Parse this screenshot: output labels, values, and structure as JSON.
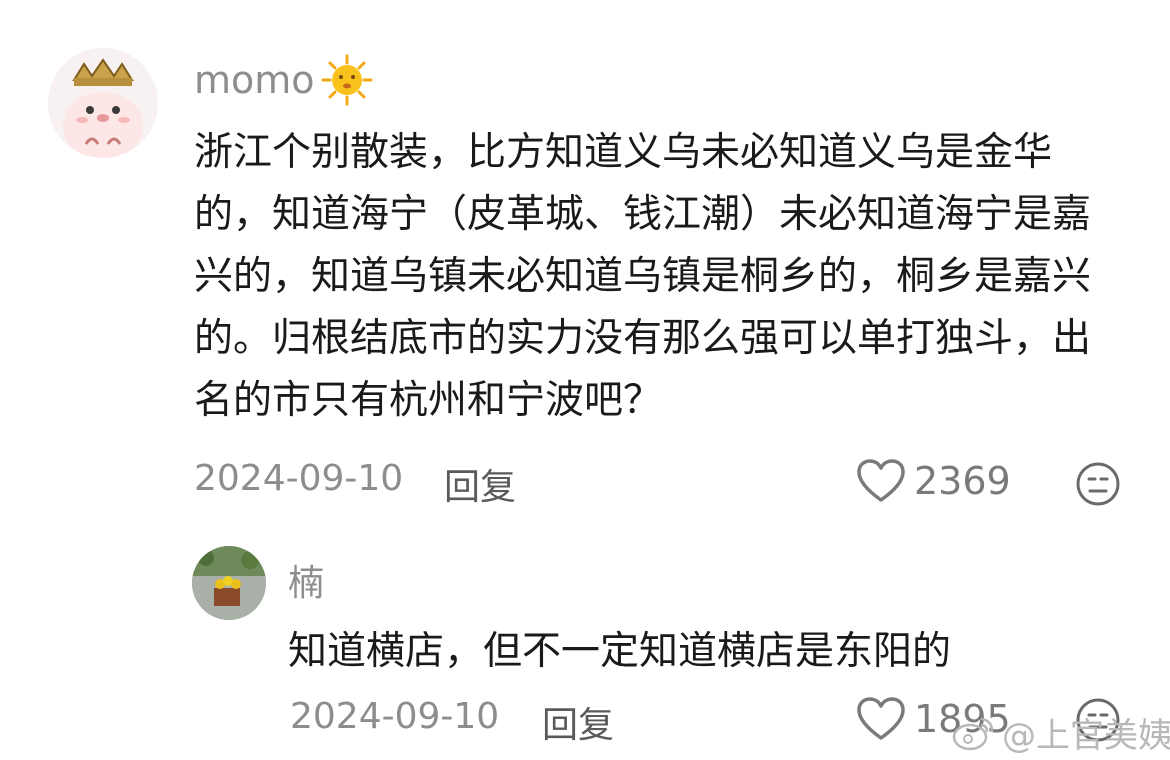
{
  "comment": {
    "username": "momo",
    "badge_icon": "sun-face-icon",
    "text": "浙江个别散装，比方知道义乌未必知道义乌是金华的，知道海宁（皮革城、钱江潮）未必知道海宁是嘉兴的，知道乌镇未必知道乌镇是桐乡的，桐乡是嘉兴的。归根结底市的实力没有那么强可以单打独斗，出名的市只有杭州和宁波吧？",
    "date": "2024-09-10",
    "reply_label": "回复",
    "likes": "2369"
  },
  "reply": {
    "username": "楠",
    "text": "知道横店，但不一定知道横店是东阳的",
    "date": "2024-09-10",
    "reply_label": "回复",
    "likes": "1895"
  },
  "watermark": "@上官美姨",
  "colors": {
    "meta_gray": "#8d8d8d",
    "text": "#1a1a1a",
    "heart": "#7a7a7a"
  }
}
